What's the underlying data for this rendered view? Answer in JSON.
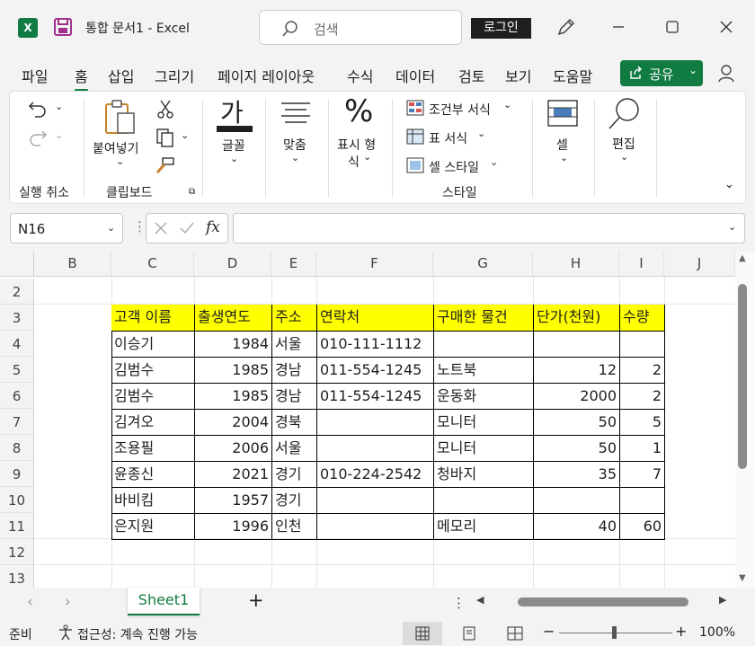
{
  "titlebar": {
    "app_icon": "X",
    "doc_title": "통합 문서1  -  Excel",
    "search_placeholder": "검색",
    "login": "로그인"
  },
  "tabs": [
    "파일",
    "홈",
    "삽입",
    "그리기",
    "페이지 레이아웃",
    "수식",
    "데이터",
    "검토",
    "보기",
    "도움말"
  ],
  "active_tab": "홈",
  "share_label": "공유",
  "ribbon": {
    "undo_group": "실행 취소",
    "paste": "붙여넣기",
    "clipboard_group": "클립보드",
    "font_glyph": "가",
    "font": "글꼴",
    "align": "맞춤",
    "number_glyph": "%",
    "number_1": "표시 형",
    "number_2": "식",
    "cond_format": "조건부 서식",
    "table_format": "표 서식",
    "cell_style": "셀 스타일",
    "style_group": "스타일",
    "cells": "셀",
    "editing": "편집"
  },
  "formula": {
    "namebox": "N16",
    "fx": "fx",
    "content": ""
  },
  "columns": [
    "B",
    "C",
    "D",
    "E",
    "F",
    "G",
    "H",
    "I",
    "J"
  ],
  "rows": [
    "2",
    "3",
    "4",
    "5",
    "6",
    "7",
    "8",
    "9",
    "10",
    "11",
    "12",
    "13"
  ],
  "table": {
    "headers": [
      "고객 이름",
      "출생연도",
      "주소",
      "연락처",
      "구매한 물건",
      "단가(천원)",
      "수량"
    ],
    "rows": [
      [
        "이승기",
        "1984",
        "서울",
        "010-111-1112",
        "",
        "",
        ""
      ],
      [
        "김범수",
        "1985",
        "경남",
        "011-554-1245",
        "노트북",
        "12",
        "2"
      ],
      [
        "김범수",
        "1985",
        "경남",
        "011-554-1245",
        "운동화",
        "2000",
        "2"
      ],
      [
        "김겨오",
        "2004",
        "경북",
        "",
        "모니터",
        "50",
        "5"
      ],
      [
        "조용필",
        "2006",
        "서울",
        "",
        "모니터",
        "50",
        "1"
      ],
      [
        "윤종신",
        "2021",
        "경기",
        "010-224-2542",
        "청바지",
        "35",
        "7"
      ],
      [
        "바비킴",
        "1957",
        "경기",
        "",
        "",
        "",
        ""
      ],
      [
        "은지원",
        "1996",
        "인천",
        "",
        "메모리",
        "40",
        "60"
      ]
    ]
  },
  "sheet_tab": "Sheet1",
  "status": {
    "ready": "준비",
    "accessibility": "접근성: 계속 진행 가능",
    "zoom": "100%"
  }
}
